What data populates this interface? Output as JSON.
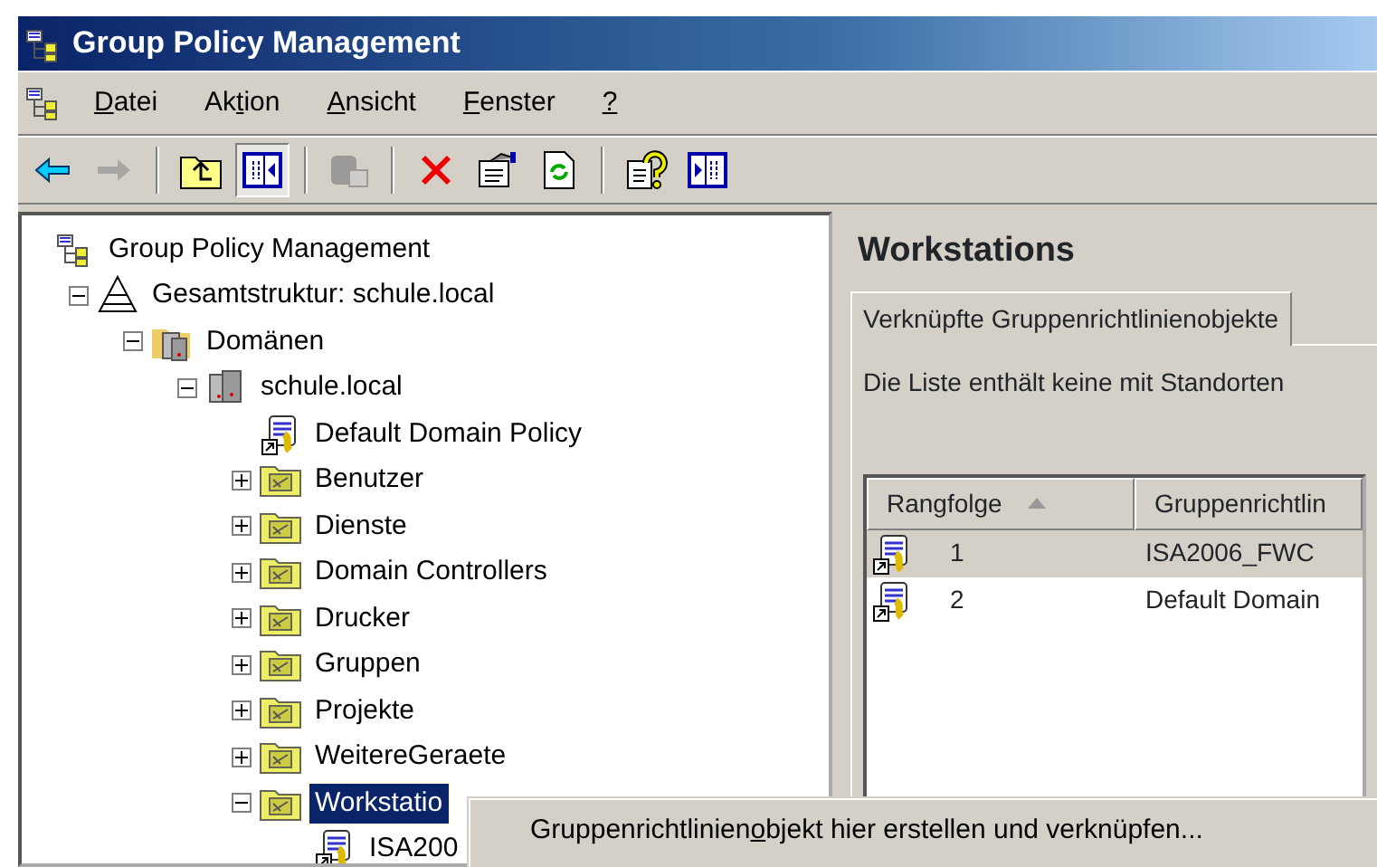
{
  "window": {
    "title": "Group Policy Management"
  },
  "menu": [
    {
      "key": "D",
      "after": "atei"
    },
    {
      "before": "Ak",
      "key": "t",
      "after": "ion"
    },
    {
      "key": "A",
      "after": "nsicht"
    },
    {
      "key": "F",
      "after": "enster"
    },
    {
      "key": "?"
    }
  ],
  "toolbar": [
    {
      "kind": "back",
      "pressed": false,
      "disabled": false
    },
    {
      "kind": "forward",
      "pressed": false,
      "disabled": true
    },
    {
      "kind": "separator"
    },
    {
      "kind": "up",
      "pressed": false,
      "disabled": false
    },
    {
      "kind": "tree-toggle",
      "pressed": true,
      "disabled": false
    },
    {
      "kind": "separator"
    },
    {
      "kind": "paste",
      "pressed": false,
      "disabled": true
    },
    {
      "kind": "separator"
    },
    {
      "kind": "delete",
      "pressed": false,
      "disabled": false
    },
    {
      "kind": "properties",
      "pressed": false,
      "disabled": false
    },
    {
      "kind": "refresh",
      "pressed": false,
      "disabled": false
    },
    {
      "kind": "separator"
    },
    {
      "kind": "help",
      "pressed": false,
      "disabled": false
    },
    {
      "kind": "action-pane",
      "pressed": false,
      "disabled": false
    }
  ],
  "tree": [
    {
      "label": "Group Policy Management",
      "kind": "root",
      "selected": false,
      "children": [
        {
          "label": "Gesamtstruktur: schule.local",
          "kind": "forest",
          "expanded": true,
          "selected": false,
          "children": [
            {
              "label": "Domänen",
              "kind": "domains",
              "expanded": true,
              "selected": false,
              "children": [
                {
                  "label": "schule.local",
                  "kind": "domain",
                  "expanded": true,
                  "selected": false,
                  "children": [
                    {
                      "label": "Default Domain Policy",
                      "kind": "gpo",
                      "selected": false
                    },
                    {
                      "label": "Benutzer",
                      "kind": "ou",
                      "expanded": false,
                      "selected": false
                    },
                    {
                      "label": "Dienste",
                      "kind": "ou",
                      "expanded": false,
                      "selected": false
                    },
                    {
                      "label": "Domain Controllers",
                      "kind": "ou",
                      "expanded": false,
                      "selected": false
                    },
                    {
                      "label": "Drucker",
                      "kind": "ou",
                      "expanded": false,
                      "selected": false
                    },
                    {
                      "label": "Gruppen",
                      "kind": "ou",
                      "expanded": false,
                      "selected": false
                    },
                    {
                      "label": "Projekte",
                      "kind": "ou",
                      "expanded": false,
                      "selected": false
                    },
                    {
                      "label": "WeitereGeraete",
                      "kind": "ou",
                      "expanded": false,
                      "selected": false
                    },
                    {
                      "label": "Workstatio",
                      "kind": "ou",
                      "expanded": true,
                      "selected": true,
                      "children": [
                        {
                          "label": "ISA200",
                          "kind": "gpo",
                          "selected": false
                        }
                      ]
                    }
                  ]
                }
              ]
            }
          ]
        }
      ]
    }
  ],
  "details": {
    "title": "Workstations",
    "tabs": [
      {
        "label": "Verknüpfte Gruppenrichtlinienobjekte",
        "selected": true
      }
    ],
    "message": "Die Liste enthält keine mit Standorten",
    "table": {
      "columns": [
        "Rangfolge",
        "Gruppenrichtlin"
      ],
      "rows": [
        {
          "cells": [
            "1",
            "ISA2006_FWC"
          ],
          "selected": true
        },
        {
          "cells": [
            "2",
            "Default Domain"
          ],
          "selected": false
        }
      ]
    }
  },
  "context_menu": {
    "items": [
      {
        "before": "Gruppenrichtlinien",
        "key": "o",
        "after": "bjekt hier erstellen und verknüpfen..."
      }
    ]
  }
}
